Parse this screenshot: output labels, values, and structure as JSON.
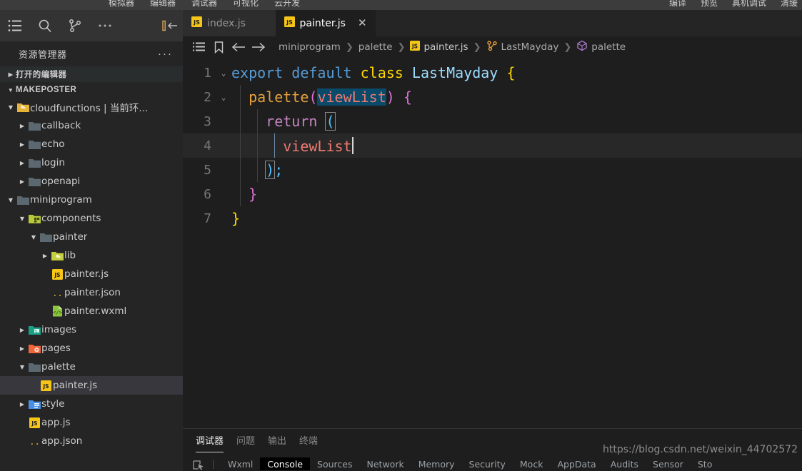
{
  "appmenu": {
    "left_items": [
      "模拟器",
      "编辑器",
      "调试器",
      "可视化",
      "云开发"
    ],
    "right_items": [
      "编译",
      "预览",
      "真机调试",
      "清缓"
    ]
  },
  "activitybar": {
    "icons": [
      {
        "name": "explorer-icon",
        "glyph": "list"
      },
      {
        "name": "search-icon",
        "glyph": "search"
      },
      {
        "name": "source-control-icon",
        "glyph": "branch"
      },
      {
        "name": "more-actions-icon",
        "glyph": "dots"
      },
      {
        "name": "collapse-sidebar-icon",
        "glyph": "collapse"
      }
    ]
  },
  "sidebar": {
    "title": "资源管理器",
    "more_label": "···",
    "open_editors_label": "打开的编辑器",
    "project_label": "MAKEPOSTER",
    "tree": [
      {
        "label": "cloudfunctions | 当前环...",
        "icon": "folder-cloud",
        "indent": 1,
        "twisty": "open",
        "selected": false
      },
      {
        "label": "callback",
        "icon": "folder",
        "indent": 2,
        "twisty": "closed",
        "selected": false
      },
      {
        "label": "echo",
        "icon": "folder",
        "indent": 2,
        "twisty": "closed",
        "selected": false
      },
      {
        "label": "login",
        "icon": "folder",
        "indent": 2,
        "twisty": "closed",
        "selected": false
      },
      {
        "label": "openapi",
        "icon": "folder",
        "indent": 2,
        "twisty": "closed",
        "selected": false
      },
      {
        "label": "miniprogram",
        "icon": "folder",
        "indent": 1,
        "twisty": "open",
        "selected": false
      },
      {
        "label": "components",
        "icon": "folder-comp",
        "indent": 2,
        "twisty": "open",
        "selected": false
      },
      {
        "label": "painter",
        "icon": "folder",
        "indent": 3,
        "twisty": "open",
        "selected": false
      },
      {
        "label": "lib",
        "icon": "folder-lib",
        "indent": 4,
        "twisty": "closed",
        "selected": false
      },
      {
        "label": "painter.js",
        "icon": "js",
        "indent": 4,
        "twisty": "none",
        "selected": false
      },
      {
        "label": "painter.json",
        "icon": "json",
        "indent": 4,
        "twisty": "none",
        "selected": false
      },
      {
        "label": "painter.wxml",
        "icon": "wxml",
        "indent": 4,
        "twisty": "none",
        "selected": false
      },
      {
        "label": "images",
        "icon": "folder-img",
        "indent": 2,
        "twisty": "closed",
        "selected": false
      },
      {
        "label": "pages",
        "icon": "folder-pages",
        "indent": 2,
        "twisty": "closed",
        "selected": false
      },
      {
        "label": "palette",
        "icon": "folder",
        "indent": 2,
        "twisty": "open",
        "selected": false
      },
      {
        "label": "painter.js",
        "icon": "js",
        "indent": 3,
        "twisty": "none",
        "selected": true
      },
      {
        "label": "style",
        "icon": "folder-style",
        "indent": 2,
        "twisty": "closed",
        "selected": false
      },
      {
        "label": "app.js",
        "icon": "js",
        "indent": 2,
        "twisty": "none",
        "selected": false
      },
      {
        "label": "app.json",
        "icon": "json",
        "indent": 2,
        "twisty": "none",
        "selected": false
      }
    ]
  },
  "editor": {
    "tabs": [
      {
        "label": "index.js",
        "icon": "js",
        "active": false,
        "closable": false
      },
      {
        "label": "painter.js",
        "icon": "js",
        "active": true,
        "closable": true,
        "close_label": "✕"
      }
    ],
    "breadcrumb_buttons": [
      {
        "name": "outline-icon",
        "glyph": "list"
      },
      {
        "name": "bookmark-icon",
        "glyph": "bookmark"
      },
      {
        "name": "back-icon",
        "glyph": "arrow-left"
      },
      {
        "name": "forward-icon",
        "glyph": "arrow-right"
      }
    ],
    "breadcrumbs": [
      {
        "label": "miniprogram",
        "icon": "none"
      },
      {
        "label": "palette",
        "icon": "none"
      },
      {
        "label": "painter.js",
        "icon": "js"
      },
      {
        "label": "LastMayday",
        "icon": "class"
      },
      {
        "label": "palette",
        "icon": "method"
      }
    ],
    "separator": "❯",
    "lines": [
      {
        "num": "1",
        "fold": "open",
        "current": false
      },
      {
        "num": "2",
        "fold": "open",
        "current": false
      },
      {
        "num": "3",
        "fold": "none",
        "current": false
      },
      {
        "num": "4",
        "fold": "none",
        "current": true
      },
      {
        "num": "5",
        "fold": "none",
        "current": false
      },
      {
        "num": "6",
        "fold": "none",
        "current": false
      },
      {
        "num": "7",
        "fold": "none",
        "current": false
      }
    ],
    "code": {
      "l1_kw_export": "export",
      "l1_kw_default": "default",
      "l1_kw_class": "class",
      "l1_name": "LastMayday",
      "l1_brace": "{",
      "l2_fn": "palette",
      "l2_paren_open": "(",
      "l2_arg": "viewList",
      "l2_paren_close": ")",
      "l2_brace": "{",
      "l3_kw_return": "return",
      "l3_paren": "(",
      "l4_var": "viewList",
      "l5_paren": ")",
      "l5_semi": ";",
      "l6_brace": "}",
      "l7_brace": "}"
    }
  },
  "panel": {
    "tabs": [
      {
        "label": "调试器",
        "active": true
      },
      {
        "label": "问题",
        "active": false
      },
      {
        "label": "输出",
        "active": false
      },
      {
        "label": "终端",
        "active": false
      }
    ],
    "devtools_tabs": [
      {
        "label": "Wxml",
        "active": false
      },
      {
        "label": "Console",
        "active": true
      },
      {
        "label": "Sources",
        "active": false
      },
      {
        "label": "Network",
        "active": false
      },
      {
        "label": "Memory",
        "active": false
      },
      {
        "label": "Security",
        "active": false
      },
      {
        "label": "Mock",
        "active": false
      },
      {
        "label": "AppData",
        "active": false
      },
      {
        "label": "Audits",
        "active": false
      },
      {
        "label": "Sensor",
        "active": false
      },
      {
        "label": "Sto",
        "active": false
      }
    ],
    "inspect_icon": "inspect-element-icon"
  },
  "watermark": "https://blog.csdn.net/weixin_44702572",
  "colors": {
    "background": "#1e1e1e",
    "sidebar_bg": "#252526",
    "selection": "#0a4a6b",
    "selected_row": "#37373d",
    "js_yellow": "#f5c518",
    "accent_blue": "#569cd6"
  }
}
